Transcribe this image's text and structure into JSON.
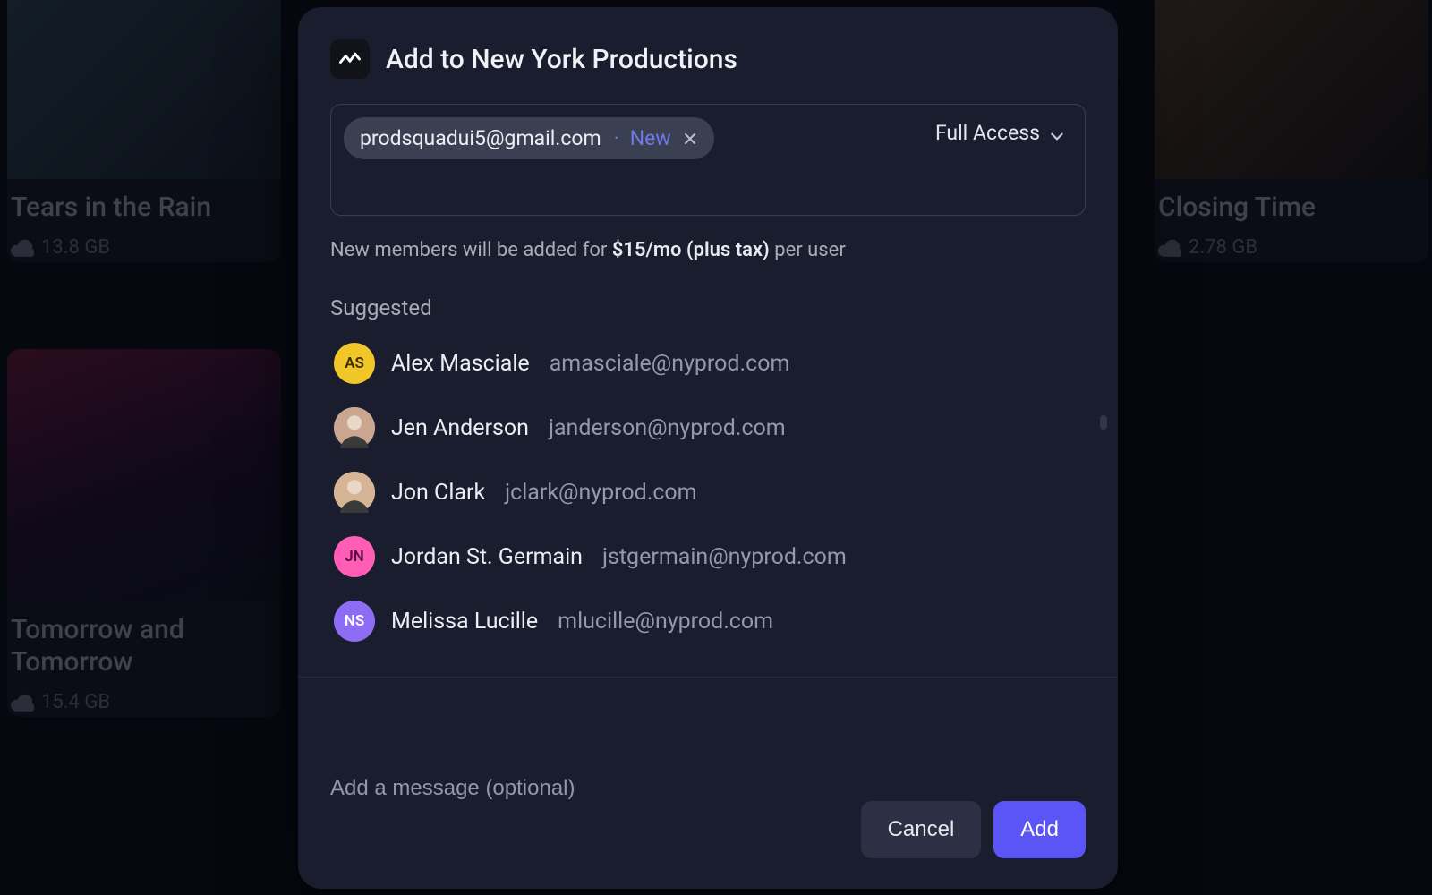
{
  "background": {
    "cards": [
      {
        "title": "Tears in the Rain",
        "size": "13.8 GB"
      },
      {
        "title": "Closing Time",
        "size": "2.78 GB"
      },
      {
        "title": "Tomorrow and Tomorrow",
        "size": "15.4 GB"
      }
    ]
  },
  "modal": {
    "title": "Add to New York Productions",
    "invite": {
      "chip_email": "prodsquadui5@gmail.com",
      "chip_sep": "·",
      "chip_tag": "New",
      "access_label": "Full Access"
    },
    "pricing_prefix": "New members will be added for ",
    "pricing_bold": "$15/mo (plus tax)",
    "pricing_suffix": " per user",
    "suggested_label": "Suggested",
    "suggested": [
      {
        "initials": "AS",
        "name": "Alex Masciale",
        "email": "amasciale@nyprod.com",
        "avatar_bg": "#f0c628",
        "avatar_fg": "#3a2f05",
        "photo": false
      },
      {
        "initials": "",
        "name": "Jen Anderson",
        "email": "janderson@nyprod.com",
        "avatar_bg": "#caa690",
        "avatar_fg": "#3a2f05",
        "photo": true
      },
      {
        "initials": "",
        "name": "Jon Clark",
        "email": "jclark@nyprod.com",
        "avatar_bg": "#d6b597",
        "avatar_fg": "#3a2f05",
        "photo": true
      },
      {
        "initials": "JN",
        "name": "Jordan St. Germain",
        "email": "jstgermain@nyprod.com",
        "avatar_bg": "#ff5db6",
        "avatar_fg": "#5a1040",
        "photo": false
      },
      {
        "initials": "NS",
        "name": "Melissa Lucille",
        "email": "mlucille@nyprod.com",
        "avatar_bg": "#8e6df5",
        "avatar_fg": "#ffffff",
        "photo": false
      }
    ],
    "message_placeholder": "Add a message (optional)",
    "cancel_label": "Cancel",
    "add_label": "Add"
  }
}
